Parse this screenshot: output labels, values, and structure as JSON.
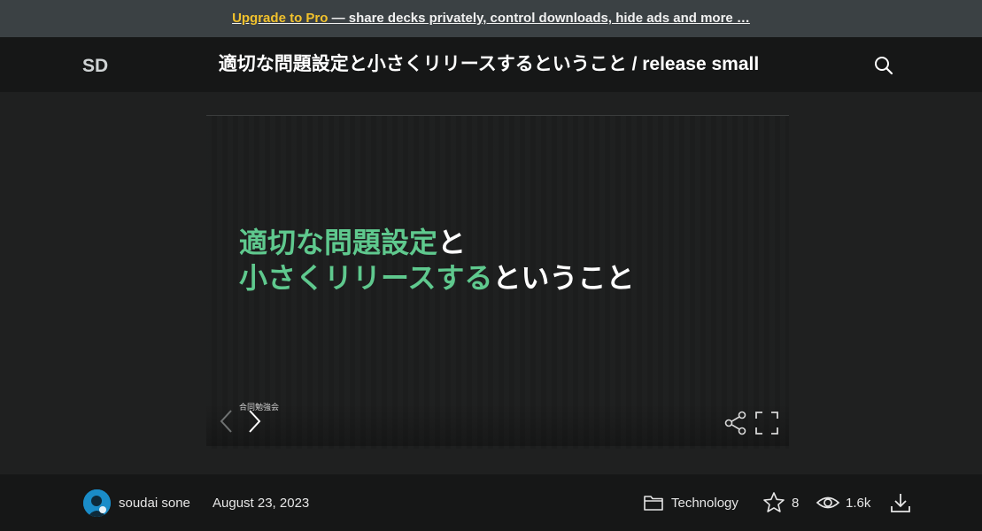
{
  "promo": {
    "link_text": "Upgrade to Pro",
    "rest_text": " — share decks privately, control downloads, hide ads and more …"
  },
  "header": {
    "logo": "SD",
    "title": "適切な問題設定と小さくリリースするということ / release small",
    "search_icon": "search-icon"
  },
  "slide": {
    "line1_green": "適切な問題設定",
    "line1_white": "と",
    "line2_green": "小さくリリースする",
    "line2_white": "ということ",
    "footer": "合同勉強会",
    "colors": {
      "green": "#5fc98e",
      "white": "#ffffff"
    }
  },
  "meta": {
    "author": "soudai sone",
    "date": "August 23, 2023",
    "category": "Technology",
    "stars": "8",
    "views": "1.6k"
  }
}
